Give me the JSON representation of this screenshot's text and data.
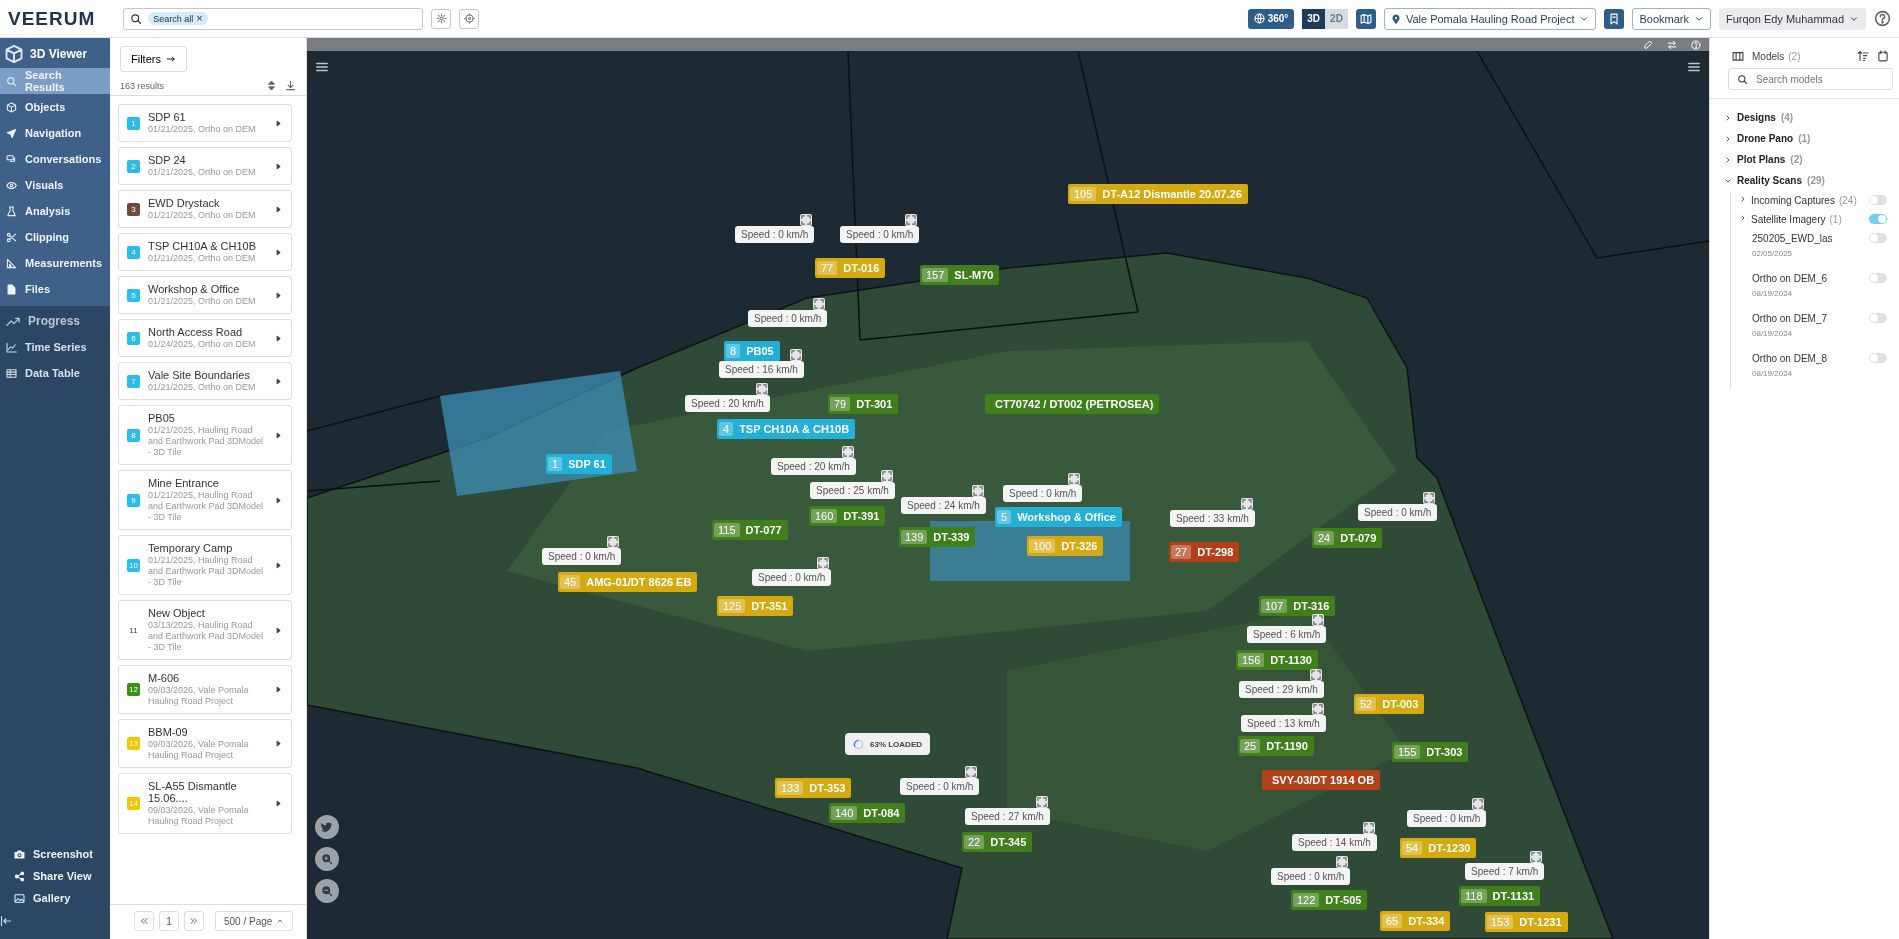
{
  "top_bar": {
    "logo": "VEERUM",
    "search": {
      "chip": "Search all",
      "chip_close": "×"
    },
    "view_360": "360°",
    "view_modes": [
      {
        "label": "3D",
        "selected": true
      },
      {
        "label": "2D",
        "selected": false
      }
    ],
    "project": "Vale Pomala Hauling Road Project",
    "bookmark": "Bookmark",
    "user": "Furqon Edy Muhammad"
  },
  "sidebar": {
    "title": "3D Viewer",
    "items": [
      {
        "label": "Search Results",
        "selected": true
      },
      {
        "label": "Objects",
        "selected": false
      },
      {
        "label": "Navigation",
        "selected": false
      },
      {
        "label": "Conversations",
        "selected": false
      },
      {
        "label": "Visuals",
        "selected": false
      },
      {
        "label": "Analysis",
        "selected": false
      },
      {
        "label": "Clipping",
        "selected": false
      },
      {
        "label": "Measurements",
        "selected": false
      },
      {
        "label": "Files",
        "selected": false
      }
    ],
    "section": "Progress",
    "section_items": [
      "Time Series",
      "Data Table"
    ],
    "footer_items": [
      "Screenshot",
      "Share View",
      "Gallery"
    ]
  },
  "results": {
    "filters_button": "Filters",
    "count": "163 results",
    "items": [
      {
        "number": "1",
        "color": "#2bbde8",
        "title": "SDP 61",
        "subtitle": "01/21/2025, Ortho on DEM"
      },
      {
        "number": "2",
        "color": "#2bbde8",
        "title": "SDP 24",
        "subtitle": "01/21/2025, Ortho on DEM"
      },
      {
        "number": "3",
        "color": "#6e4a3c",
        "title": "EWD Drystack",
        "subtitle": "01/21/2025, Ortho on DEM"
      },
      {
        "number": "4",
        "color": "#2bbde8",
        "title": "TSP CH10A & CH10B",
        "subtitle": "01/21/2025, Ortho on DEM"
      },
      {
        "number": "5",
        "color": "#2bbde8",
        "title": "Workshop & Office",
        "subtitle": "01/21/2025, Ortho on DEM"
      },
      {
        "number": "6",
        "color": "#2bbde8",
        "title": "North Access Road",
        "subtitle": "01/24/2025, Ortho on DEM"
      },
      {
        "number": "7",
        "color": "#2bbde8",
        "title": "Vale Site Boundaries",
        "subtitle": "01/21/2025, Ortho on DEM"
      },
      {
        "number": "8",
        "color": "#2bbde8",
        "title": "PB05",
        "subtitle": "01/21/2025, Hauling Road and Earthwork Pad 3DModel - 3D Tile"
      },
      {
        "number": "9",
        "color": "#2bbde8",
        "title": "Mine Entrance",
        "subtitle": "01/21/2025, Hauling Road and Earthwork Pad 3DModel - 3D Tile"
      },
      {
        "number": "10",
        "color": "#2bbde8",
        "title": "Temporary Camp",
        "subtitle": "01/21/2025, Hauling Road and Earthwork Pad 3DModel - 3D Tile"
      },
      {
        "number": "11",
        "title": "New Object",
        "subtitle": "03/13/2025, Hauling Road and Earthwork Pad 3DModel - 3D Tile"
      },
      {
        "number": "12",
        "color": "#3a8f12",
        "title": "M-606",
        "subtitle": "09/03/2026, Vale Pomala Hauling Road Project"
      },
      {
        "number": "13",
        "color": "#f5c400",
        "title": "BBM-09",
        "subtitle": "09/03/2026, Vale Pomala Hauling Road Project"
      },
      {
        "number": "14",
        "color": "#f5c400",
        "title": "SL-A55 Dismantle 15.06....",
        "subtitle": "09/03/2026, Vale Pomala Hauling Road Project"
      }
    ],
    "pagination": {
      "page": "1",
      "page_size": "500 / Page"
    }
  },
  "map": {
    "markers": [
      {
        "number": "105",
        "label": "DT-A12 Dismantle 20.07.26",
        "color": "#d4aa10"
      },
      {
        "number": "77",
        "label": "DT-016",
        "color": "#d4aa10"
      },
      {
        "number": "157",
        "label": "SL-M70",
        "color": "#3f7f1c"
      },
      {
        "number": "8",
        "label": "PB05",
        "color": "#22b0d8"
      },
      {
        "number": "79",
        "label": "DT-301",
        "color": "#3f7f1c"
      },
      {
        "number": "4",
        "label": "TSP CH10A & CH10B",
        "color": "#22b0d8"
      },
      {
        "number": "1",
        "label": "SDP 61",
        "color": "#22b0d8"
      },
      {
        "label": "CT70742 / DT002 (PETROSEA)",
        "color": "#3f7f1c"
      },
      {
        "number": "115",
        "label": "DT-077",
        "color": "#3f7f1c"
      },
      {
        "number": "160",
        "label": "DT-391",
        "color": "#3f7f1c"
      },
      {
        "number": "139",
        "label": "DT-339",
        "color": "#3f7f1c"
      },
      {
        "number": "5",
        "label": "Workshop & Office",
        "color": "#22b0d8"
      },
      {
        "number": "100",
        "label": "DT-326",
        "color": "#d4aa10"
      },
      {
        "number": "45",
        "label": "AMG-01/DT 8626 EB",
        "color": "#d4aa10"
      },
      {
        "number": "125",
        "label": "DT-351",
        "color": "#d4aa10"
      },
      {
        "number": "27",
        "label": "DT-298",
        "color": "#b3401a"
      },
      {
        "number": "24",
        "label": "DT-079",
        "color": "#3f7f1c"
      },
      {
        "number": "107",
        "label": "DT-316",
        "color": "#3f7f1c"
      },
      {
        "number": "156",
        "label": "DT-1130",
        "color": "#3f7f1c"
      },
      {
        "number": "52",
        "label": "DT-003",
        "color": "#d4aa10"
      },
      {
        "number": "25",
        "label": "DT-1190",
        "color": "#3f7f1c"
      },
      {
        "label": "SVY-03/DT 1914 OB",
        "color": "#b3401a"
      },
      {
        "number": "155",
        "label": "DT-303",
        "color": "#3f7f1c"
      },
      {
        "number": "133",
        "label": "DT-353",
        "color": "#d4aa10"
      },
      {
        "number": "140",
        "label": "DT-084",
        "color": "#3f7f1c"
      },
      {
        "number": "22",
        "label": "DT-345",
        "color": "#3f7f1c"
      },
      {
        "number": "54",
        "label": "DT-1230",
        "color": "#d4aa10"
      },
      {
        "number": "122",
        "label": "DT-505",
        "color": "#3f7f1c"
      },
      {
        "number": "118",
        "label": "DT-1131",
        "color": "#3f7f1c"
      },
      {
        "number": "65",
        "label": "DT-334",
        "color": "#d4aa10"
      },
      {
        "number": "153",
        "label": "DT-1231",
        "color": "#d4aa10"
      }
    ],
    "speed_labels": [
      "Speed : 0 km/h",
      "Speed : 0 km/h",
      "Speed : 0 km/h",
      "Speed : 16 km/h",
      "Speed : 20 km/h",
      "Speed : 20 km/h",
      "Speed : 25 km/h",
      "Speed : 24 km/h",
      "Speed : 0 km/h",
      "Speed : 33 km/h",
      "Speed : 0 km/h",
      "Speed : 6 km/h",
      "Speed : 29 km/h",
      "Speed : 13 km/h",
      "Speed : 0 km/h",
      "Speed : 27 km/h",
      "Speed : 14 km/h",
      "Speed : 0 km/h",
      "Speed : 7 km/h",
      "Speed : 0 km/h",
      "Speed : 0 km/h",
      "Speed : 0 km/h"
    ],
    "loading": "63% LOADED"
  },
  "models_panel": {
    "title": "Models",
    "count": "(2)",
    "search": {
      "placeholder": "Search models"
    },
    "groups": [
      {
        "label": "Designs",
        "count": "(4)",
        "expanded": false
      },
      {
        "label": "Drone Pano",
        "count": "(1)",
        "expanded": false
      },
      {
        "label": "Plot Plans",
        "count": "(2)",
        "expanded": false
      },
      {
        "label": "Reality Scans",
        "count": "(29)",
        "expanded": true,
        "children": [
          {
            "kind": "group",
            "label": "Incoming Captures",
            "count": "(24)",
            "expanded": false,
            "on": false
          },
          {
            "kind": "group",
            "label": "Satellite Imagery",
            "count": "(1)",
            "expanded": false,
            "on": true
          },
          {
            "kind": "layer",
            "label": "250205_EWD_las",
            "date": "02/05/2025",
            "on": false
          },
          {
            "kind": "layer",
            "label": "Ortho on DEM_6",
            "date": "08/19/2024",
            "on": false
          },
          {
            "kind": "layer",
            "label": "Ortho on DEM_7",
            "date": "08/19/2024",
            "on": false
          },
          {
            "kind": "layer",
            "label": "Ortho on DEM_8",
            "date": "08/19/2024",
            "on": false
          }
        ]
      }
    ]
  }
}
